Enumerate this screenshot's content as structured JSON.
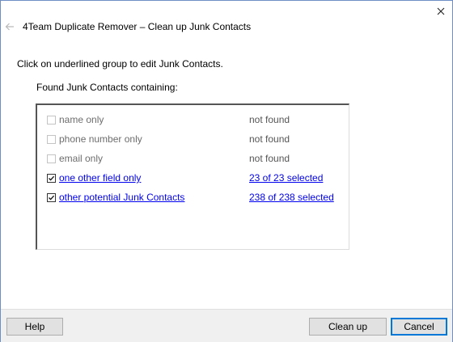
{
  "window": {
    "title": "4Team Duplicate Remover – Clean up Junk Contacts"
  },
  "instruction": "Click on underlined group to edit Junk Contacts.",
  "found_label": "Found Junk Contacts containing:",
  "rows": [
    {
      "label": "name only",
      "status": "not found",
      "checked": false,
      "enabled": false
    },
    {
      "label": "phone number only",
      "status": "not found",
      "checked": false,
      "enabled": false
    },
    {
      "label": "email only",
      "status": "not found",
      "checked": false,
      "enabled": false
    },
    {
      "label": "one other field only",
      "status": "23 of 23 selected",
      "checked": true,
      "enabled": true
    },
    {
      "label": "other potential Junk Contacts",
      "status": "238 of 238 selected",
      "checked": true,
      "enabled": true
    }
  ],
  "buttons": {
    "help": "Help",
    "clean_up": "Clean up",
    "cancel": "Cancel"
  },
  "icons": {
    "back": "back-arrow-icon",
    "close": "close-icon",
    "check": "checkmark-icon"
  },
  "colors": {
    "link": "#0000ee",
    "focus_border": "#0078d7",
    "window_border": "#6d8fc5"
  }
}
